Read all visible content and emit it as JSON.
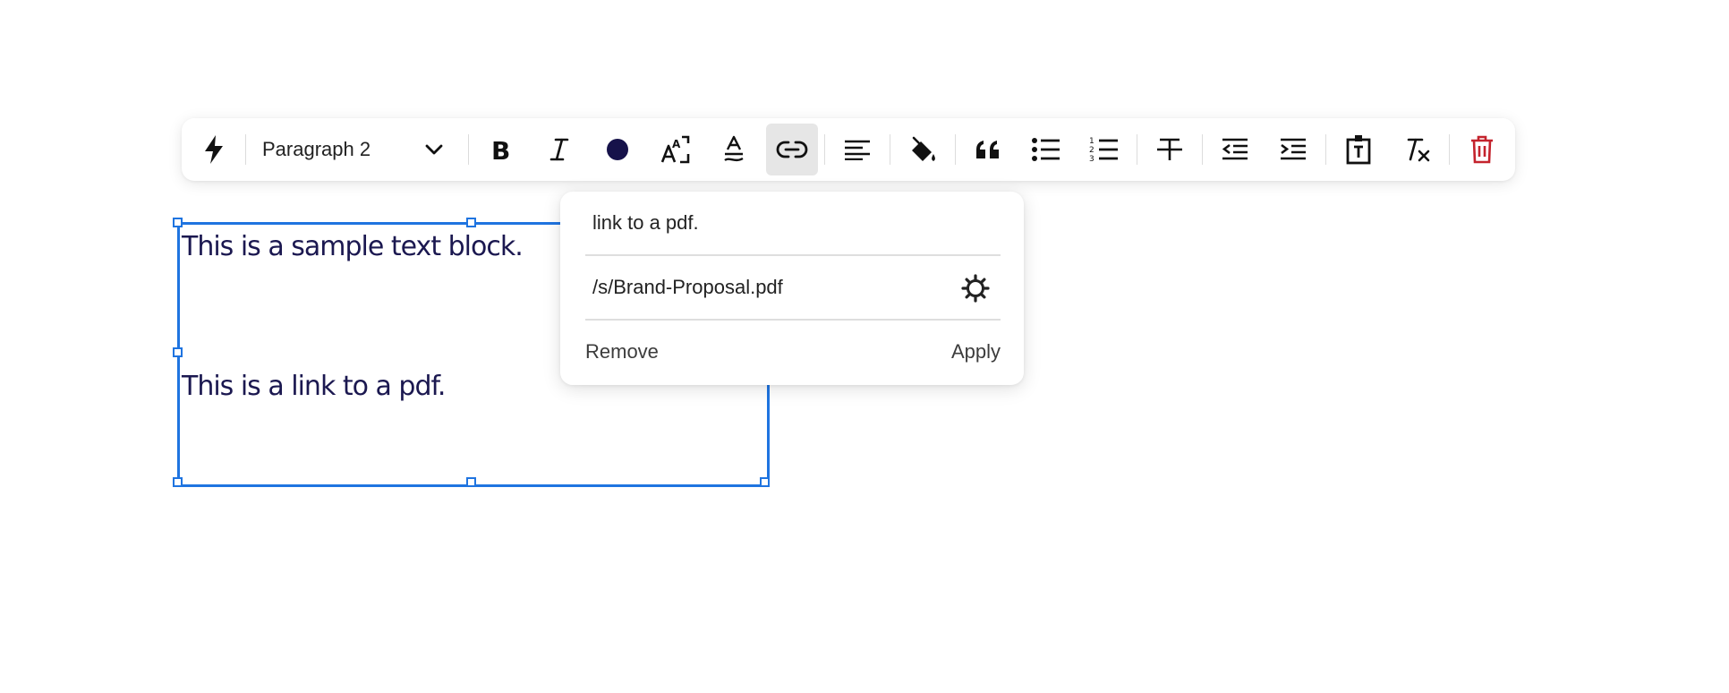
{
  "toolbar": {
    "paragraph_style": "Paragraph 2",
    "buttons": [
      {
        "name": "lightning-icon"
      },
      {
        "name": "bold-icon"
      },
      {
        "name": "italic-icon"
      },
      {
        "name": "text-color-icon",
        "color": "#16124a"
      },
      {
        "name": "text-highlight-icon"
      },
      {
        "name": "text-style-icon"
      },
      {
        "name": "link-icon",
        "active": true
      },
      {
        "name": "align-left-icon"
      },
      {
        "name": "fill-color-icon"
      },
      {
        "name": "quote-icon"
      },
      {
        "name": "bulleted-list-icon"
      },
      {
        "name": "numbered-list-icon"
      },
      {
        "name": "strikethrough-icon"
      },
      {
        "name": "decrease-indent-icon"
      },
      {
        "name": "increase-indent-icon"
      },
      {
        "name": "text-box-icon"
      },
      {
        "name": "clear-formatting-icon"
      },
      {
        "name": "trash-icon",
        "color": "#c4232d"
      }
    ]
  },
  "text_block": {
    "line1": "This is a sample text block.",
    "line2": "This is a link to a pdf.",
    "text_color": "#1b1850",
    "selection_color": "#1f74e0"
  },
  "link_popover": {
    "link_text": "link to a pdf.",
    "url": "/s/Brand-Proposal.pdf",
    "remove_label": "Remove",
    "apply_label": "Apply"
  }
}
